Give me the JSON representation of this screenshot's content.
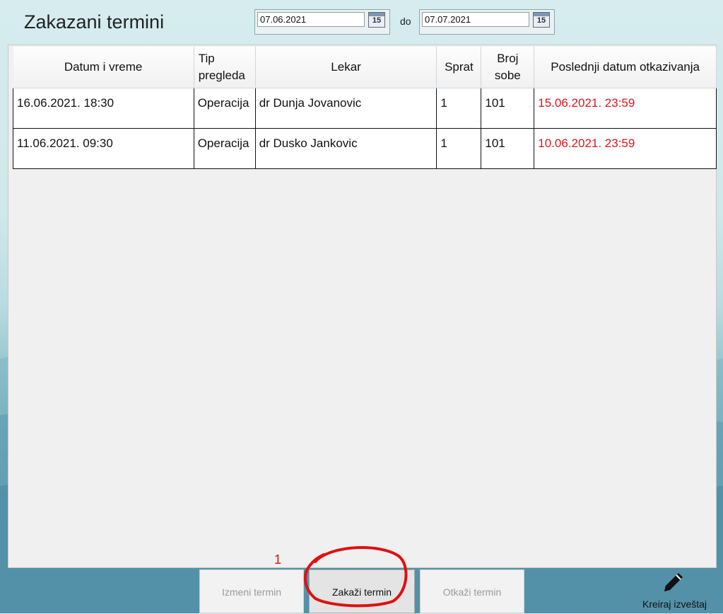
{
  "page": {
    "title": "Zakazani termini"
  },
  "filter": {
    "from_value": "07.06.2021",
    "to_label": "do",
    "to_value": "07.07.2021",
    "calendar_icon_text": "15"
  },
  "table": {
    "columns": [
      "Datum i vreme",
      "Tip pregleda",
      "Lekar",
      "Sprat",
      "Broj sobe",
      "Poslednji datum otkazivanja"
    ],
    "rows": [
      {
        "datetime": "16.06.2021. 18:30",
        "type": "Operacija",
        "doctor": "dr Dunja Jovanovic",
        "floor": "1",
        "room": "101",
        "cancel_deadline": "15.06.2021. 23:59"
      },
      {
        "datetime": "11.06.2021. 09:30",
        "type": "Operacija",
        "doctor": "dr Dusko Jankovic",
        "floor": "1",
        "room": "101",
        "cancel_deadline": "10.06.2021. 23:59"
      }
    ]
  },
  "actions": {
    "edit_label": "Izmeni termin",
    "schedule_label": "Zakaži termin",
    "cancel_label": "Otkaži termin",
    "report_label": "Kreiraj izveštaj",
    "report_icon": "pencil-icon"
  },
  "annotation": {
    "number": "1",
    "color": "#e01010"
  },
  "colors": {
    "deadline_red": "#e0141a",
    "panel_bg": "#f0f0f0"
  }
}
